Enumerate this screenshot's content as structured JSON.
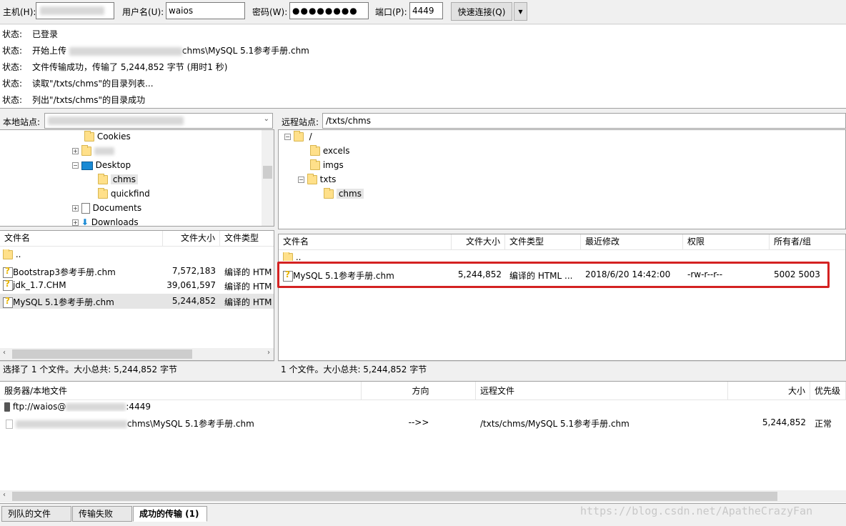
{
  "quickconnect": {
    "host_label": "主机(H):",
    "user_label": "用户名(U):",
    "user_value": "waios",
    "pass_label": "密码(W):",
    "pass_value": "●●●●●●●●",
    "port_label": "端口(P):",
    "port_value": "4449",
    "connect_label": "快速连接(Q)",
    "dropdown_glyph": "▼"
  },
  "log": [
    {
      "k": "状态:",
      "v": "已登录"
    },
    {
      "k": "状态:",
      "v_pre": "开始上传 ",
      "v": "chms\\MySQL 5.1参考手册.chm"
    },
    {
      "k": "状态:",
      "v": "文件传输成功，传输了 5,244,852 字节 (用时1 秒)"
    },
    {
      "k": "状态:",
      "v": "读取\"/txts/chms\"的目录列表..."
    },
    {
      "k": "状态:",
      "v": "列出\"/txts/chms\"的目录成功"
    }
  ],
  "local": {
    "site_label": "本地站点:",
    "tree": [
      "Cookies",
      "Desktop",
      "chms",
      "quickfind",
      "Documents",
      "Downloads"
    ],
    "headers": {
      "name": "文件名",
      "size": "文件大小",
      "type": "文件类型"
    },
    "files": [
      {
        "name": "..",
        "size": "",
        "type": ""
      },
      {
        "name": "Bootstrap3参考手册.chm",
        "size": "7,572,183",
        "type": "编译的 HTM"
      },
      {
        "name": "jdk_1.7.CHM",
        "size": "39,061,597",
        "type": "编译的 HTM"
      },
      {
        "name": "MySQL 5.1参考手册.chm",
        "size": "5,244,852",
        "type": "编译的 HTM"
      }
    ],
    "status": "选择了 1 个文件。大小总共: 5,244,852 字节"
  },
  "remote": {
    "site_label": "远程站点:",
    "path": "/txts/chms",
    "tree": [
      "/",
      "excels",
      "imgs",
      "txts",
      "chms"
    ],
    "headers": {
      "name": "文件名",
      "size": "文件大小",
      "type": "文件类型",
      "modified": "最近修改",
      "perms": "权限",
      "owner": "所有者/组"
    },
    "files": [
      {
        "name": "..",
        "size": "",
        "type": "",
        "modified": "",
        "perms": "",
        "owner": ""
      },
      {
        "name": "MySQL 5.1参考手册.chm",
        "size": "5,244,852",
        "type": "编译的 HTML ...",
        "modified": "2018/6/20 14:42:00",
        "perms": "-rw-r--r--",
        "owner": "5002 5003"
      }
    ],
    "status": "1 个文件。大小总共: 5,244,852 字节"
  },
  "queue": {
    "headers": {
      "server": "服务器/本地文件",
      "direction": "方向",
      "remote": "远程文件",
      "size": "大小",
      "priority": "优先级"
    },
    "server_pre": "ftp://waios@",
    "server_post": ":4449",
    "item": {
      "local_suffix": "chms\\MySQL 5.1参考手册.chm",
      "direction": "-->>",
      "remote": "/txts/chms/MySQL 5.1参考手册.chm",
      "size": "5,244,852",
      "priority": "正常"
    }
  },
  "tabs": [
    "列队的文件",
    "传输失败",
    "成功的传输 (1)"
  ],
  "watermark": "https://blog.csdn.net/ApatheCrazyFan",
  "colors": {
    "highlight": "#d42222",
    "selection": "#e5e5e5"
  }
}
